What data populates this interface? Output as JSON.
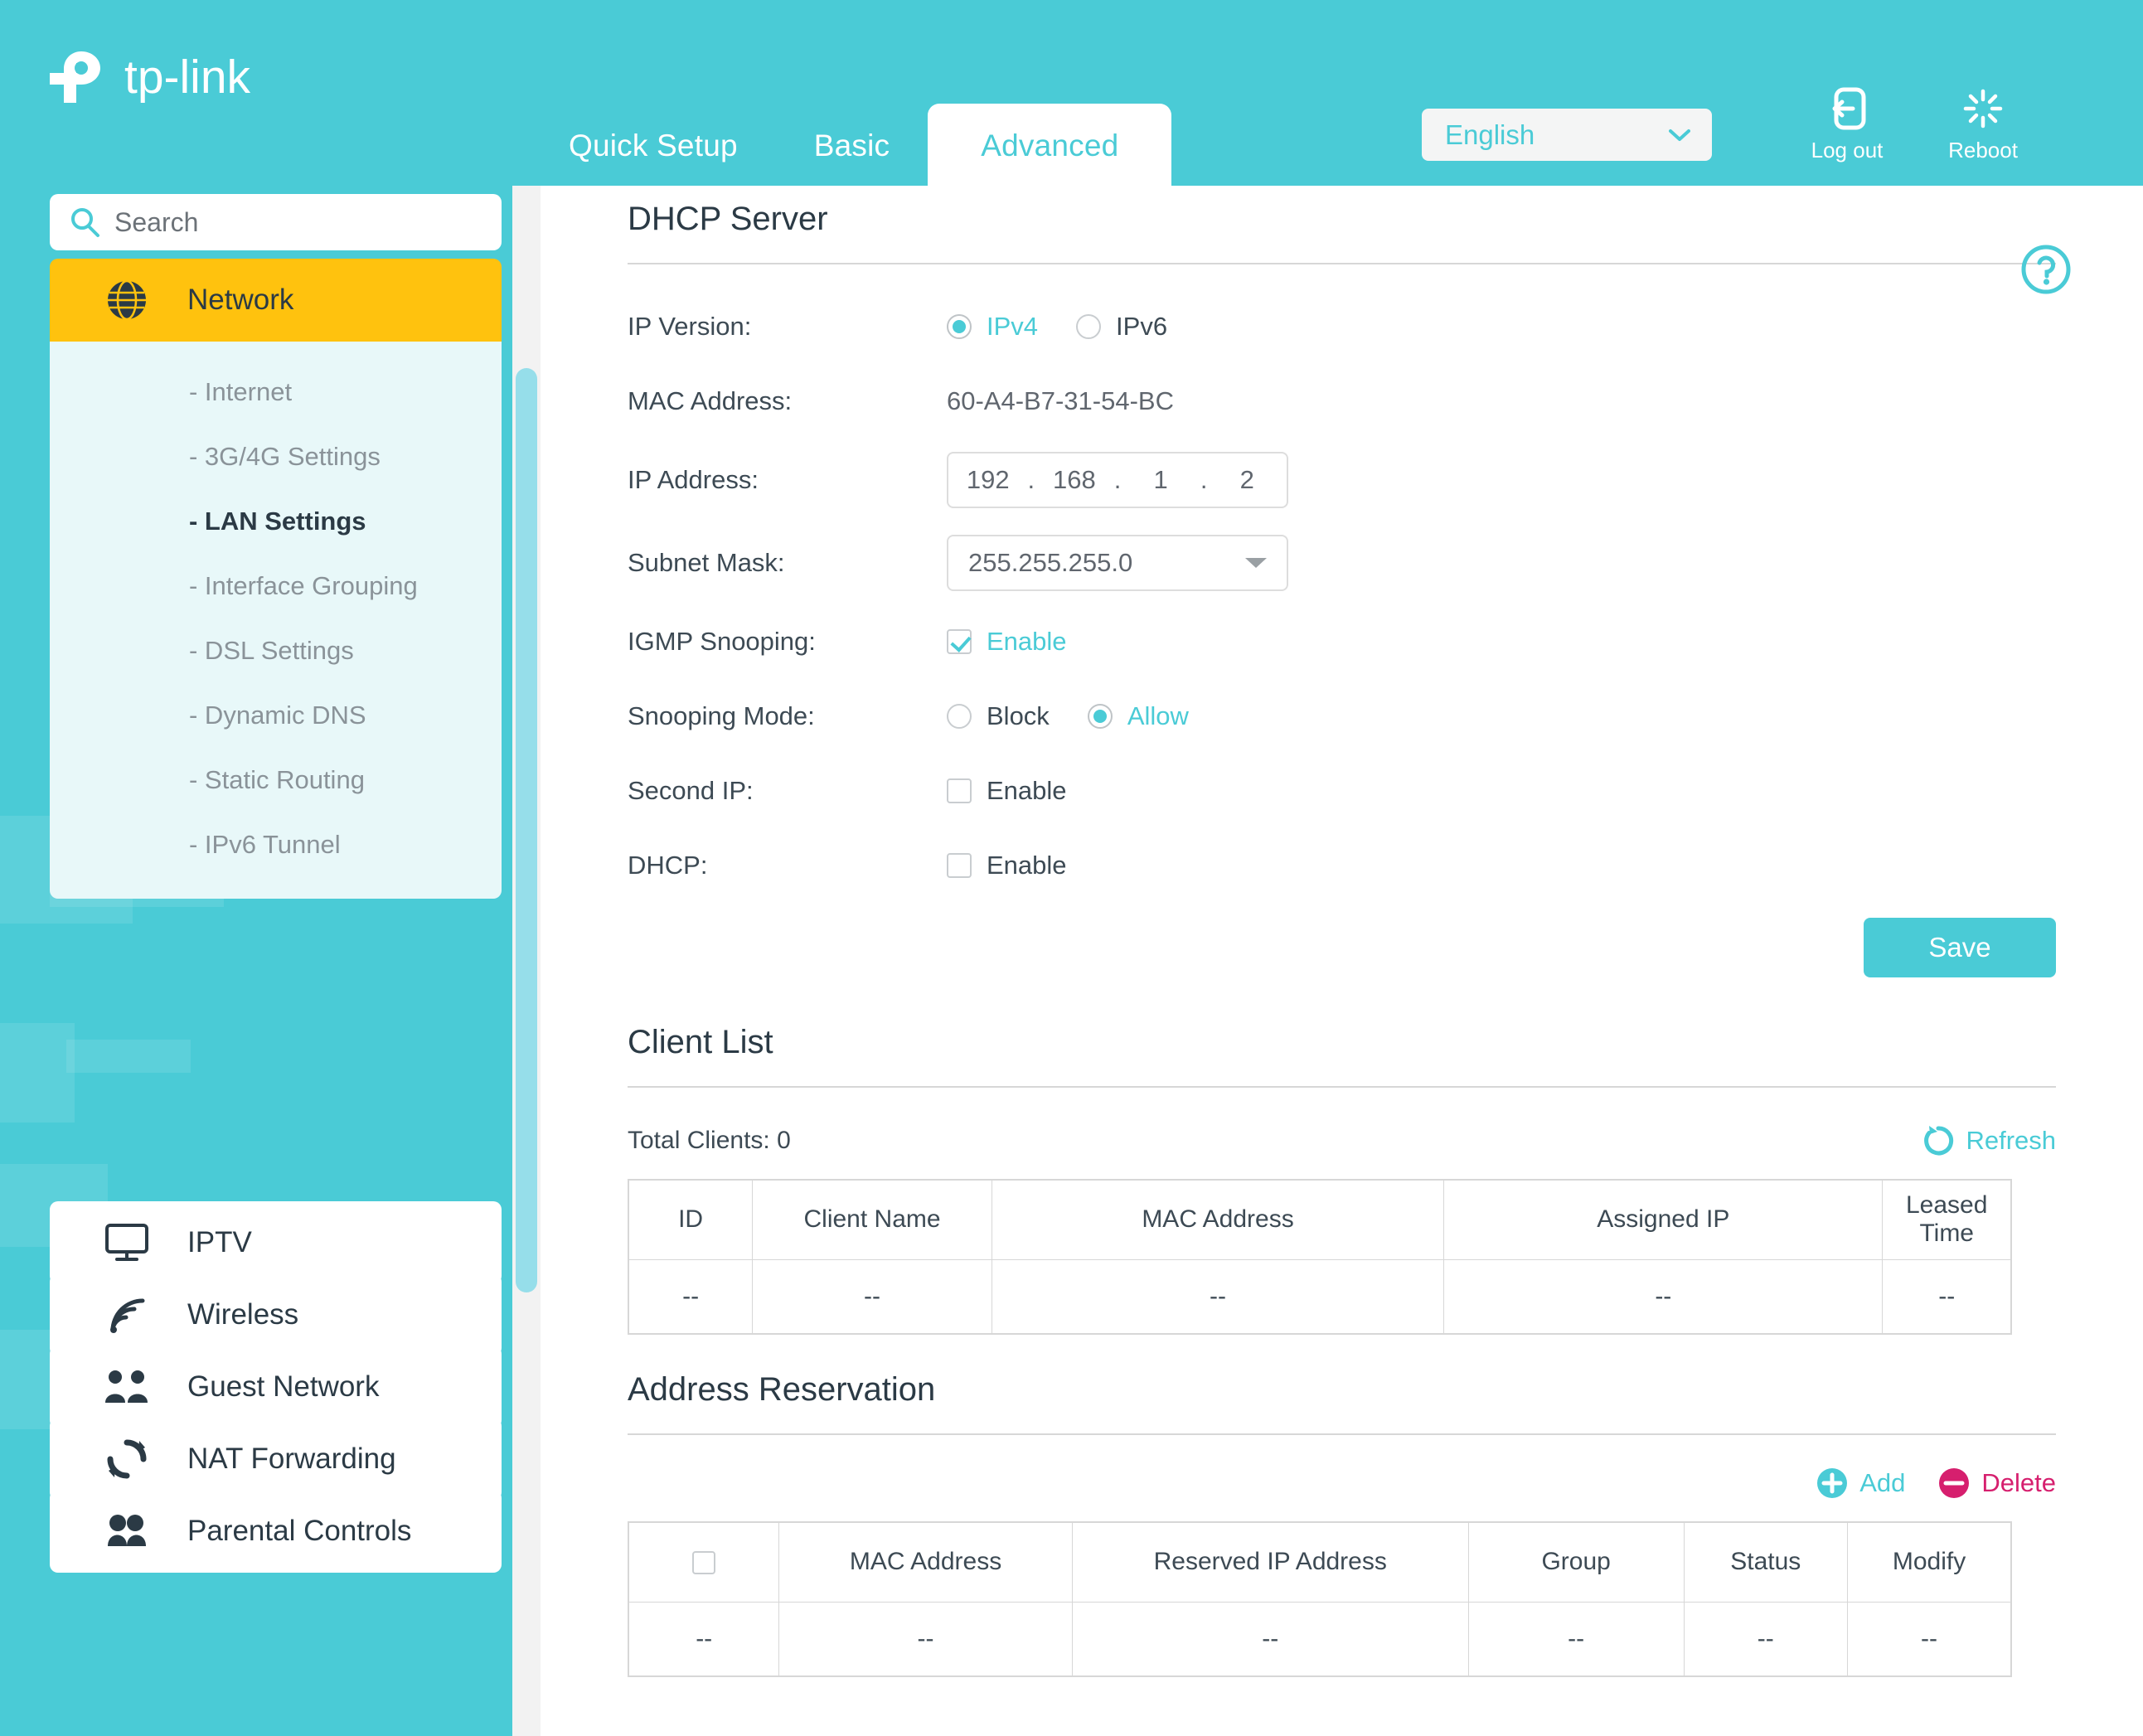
{
  "brand": {
    "name": "tp-link"
  },
  "header": {
    "tabs": [
      {
        "label": "Quick Setup",
        "active": false
      },
      {
        "label": "Basic",
        "active": false
      },
      {
        "label": "Advanced",
        "active": true
      }
    ],
    "language": "English",
    "logout_label": "Log out",
    "reboot_label": "Reboot"
  },
  "sidebar": {
    "search_placeholder": "Search",
    "groups": [
      {
        "label": "Network",
        "icon": "globe-icon",
        "selected": true,
        "items": [
          {
            "label": "- Internet",
            "selected": false
          },
          {
            "label": "- 3G/4G Settings",
            "selected": false
          },
          {
            "label": "- LAN Settings",
            "selected": true
          },
          {
            "label": "- Interface Grouping",
            "selected": false
          },
          {
            "label": "- DSL Settings",
            "selected": false
          },
          {
            "label": "- Dynamic DNS",
            "selected": false
          },
          {
            "label": "- Static Routing",
            "selected": false
          },
          {
            "label": "- IPv6 Tunnel",
            "selected": false
          }
        ]
      },
      {
        "label": "IPTV",
        "icon": "monitor-icon",
        "selected": false,
        "items": []
      },
      {
        "label": "Wireless",
        "icon": "wifi-icon",
        "selected": false,
        "items": []
      },
      {
        "label": "Guest Network",
        "icon": "people-icon",
        "selected": false,
        "items": []
      },
      {
        "label": "NAT Forwarding",
        "icon": "refresh-circle-icon",
        "selected": false,
        "items": []
      },
      {
        "label": "Parental Controls",
        "icon": "parental-icon",
        "selected": false,
        "items": []
      }
    ]
  },
  "dhcp_server": {
    "title": "DHCP Server",
    "ip_version": {
      "label": "IP Version:",
      "options": [
        {
          "label": "IPv4",
          "selected": true
        },
        {
          "label": "IPv6",
          "selected": false
        }
      ]
    },
    "mac_address": {
      "label": "MAC Address:",
      "value": "60-A4-B7-31-54-BC"
    },
    "ip_address": {
      "label": "IP Address:",
      "octets": [
        "192",
        "168",
        "1",
        "2"
      ]
    },
    "subnet_mask": {
      "label": "Subnet Mask:",
      "value": "255.255.255.0"
    },
    "igmp_snooping": {
      "label": "IGMP Snooping:",
      "checkbox_label": "Enable",
      "checked": true
    },
    "snooping_mode": {
      "label": "Snooping Mode:",
      "options": [
        {
          "label": "Block",
          "selected": false
        },
        {
          "label": "Allow",
          "selected": true
        }
      ]
    },
    "second_ip": {
      "label": "Second IP:",
      "checkbox_label": "Enable",
      "checked": false
    },
    "dhcp": {
      "label": "DHCP:",
      "checkbox_label": "Enable",
      "checked": false
    },
    "save_label": "Save"
  },
  "client_list": {
    "title": "Client List",
    "total_clients_label": "Total Clients: 0",
    "refresh_label": "Refresh",
    "columns": [
      "ID",
      "Client Name",
      "MAC Address",
      "Assigned IP",
      "Leased Time"
    ],
    "rows": [
      [
        "--",
        "--",
        "--",
        "--",
        "--"
      ]
    ]
  },
  "address_reservation": {
    "title": "Address Reservation",
    "add_label": "Add",
    "delete_label": "Delete",
    "columns": [
      "",
      "MAC Address",
      "Reserved IP Address",
      "Group",
      "Status",
      "Modify"
    ],
    "rows": [
      [
        "--",
        "--",
        "--",
        "--",
        "--",
        "--"
      ]
    ]
  },
  "colors": {
    "brand_teal": "#4ACBD6",
    "accent_yellow": "#FFC20E",
    "delete_pink": "#D61F6E",
    "submenu_bg": "#E8F8F9",
    "text_dark": "#2B3A45"
  }
}
